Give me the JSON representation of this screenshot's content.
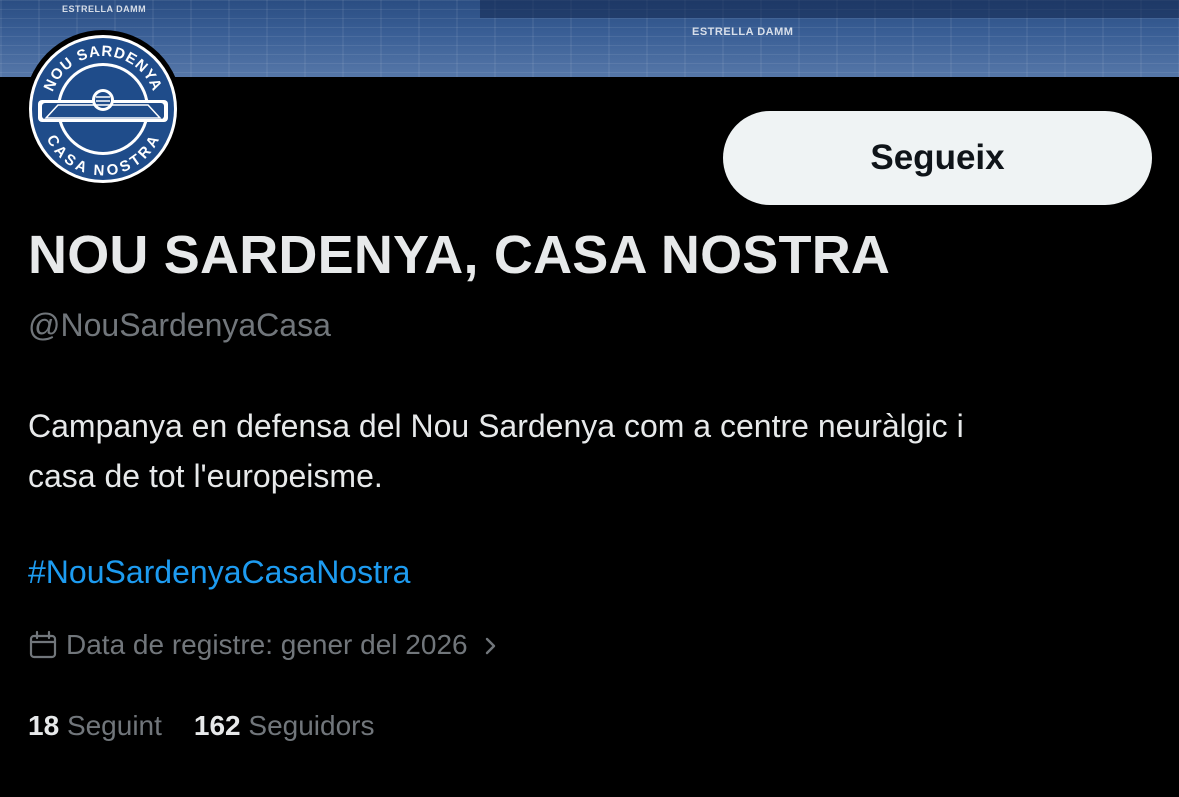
{
  "banner": {
    "signs": [
      "ESTRELLA DAMM",
      "ESTRELLA DAMM"
    ]
  },
  "avatar": {
    "logo_top_text": "NOU SARDENYA",
    "logo_bottom_text": "CASA NOSTRA"
  },
  "profile": {
    "follow_label": "Segueix",
    "display_name": "NOU SARDENYA, CASA NOSTRA",
    "handle": "@NouSardenyaCasa",
    "bio_line1": "Campanya en defensa del Nou Sardenya com a centre neuràlgic i",
    "bio_line2": "casa de tot l'europeisme.",
    "hashtag": "#NouSardenyaCasaNostra",
    "joined": "Data de registre: gener del 2026",
    "joined_icon": "calendar-icon",
    "chevron_icon": "chevron-right-icon"
  },
  "stats": {
    "following_count": "18",
    "following_label": "Seguint",
    "followers_count": "162",
    "followers_label": "Seguidors"
  },
  "colors": {
    "background": "#000000",
    "text": "#e7e9ea",
    "secondary_text": "#71767b",
    "link": "#1d9bf0",
    "follow_button_bg": "#eff3f4",
    "banner": "#3a5f96"
  }
}
